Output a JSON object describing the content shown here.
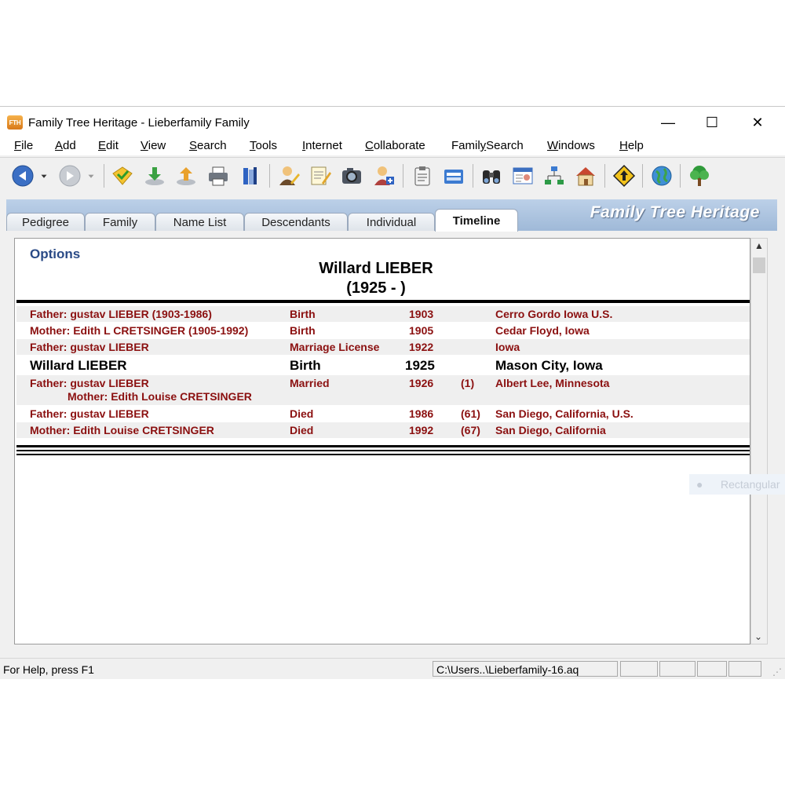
{
  "window": {
    "app_icon": "FTH",
    "title": "Family Tree Heritage - Lieberfamily Family",
    "controls": {
      "minimize": "—",
      "maximize": "☐",
      "close": "✕"
    }
  },
  "menu": [
    {
      "label": "File",
      "u": "F",
      "rest": "ile"
    },
    {
      "label": "Add",
      "u": "A",
      "rest": "dd"
    },
    {
      "label": "Edit",
      "u": "E",
      "rest": "dit"
    },
    {
      "label": "View",
      "u": "V",
      "rest": "iew"
    },
    {
      "label": "Search",
      "u": "S",
      "rest": "earch"
    },
    {
      "label": "Tools",
      "u": "T",
      "rest": "ools"
    },
    {
      "label": "Internet",
      "u": "I",
      "rest": "nternet"
    },
    {
      "label": "Collaborate",
      "u": "C",
      "rest": "ollaborate"
    },
    {
      "label": "FamilySearch",
      "pre": "Famil",
      "u": "y",
      "rest": "Search"
    },
    {
      "label": "Windows",
      "u": "W",
      "rest": "indows"
    },
    {
      "label": "Help",
      "u": "H",
      "rest": "elp"
    }
  ],
  "toolbar_icons": [
    "back-arrow-icon",
    "dropdown-arrow-icon",
    "forward-arrow-icon",
    "dropdown-arrow-icon",
    "open-file-icon",
    "download-icon",
    "upload-icon",
    "print-icon",
    "books-icon",
    "edit-person-icon",
    "notes-icon",
    "camera-icon",
    "add-person-icon",
    "clipboard-icon",
    "card-file-icon",
    "binoculars-icon",
    "profile-card-icon",
    "tree-chart-icon",
    "home-icon",
    "direction-sign-icon",
    "globe-icon",
    "tree-icon"
  ],
  "brand": "Family Tree Heritage",
  "tabs": [
    {
      "label": "Pedigree",
      "active": false
    },
    {
      "label": "Family",
      "active": false
    },
    {
      "label": "Name List",
      "active": false
    },
    {
      "label": "Descendants",
      "active": false
    },
    {
      "label": "Individual",
      "active": false
    },
    {
      "label": "Timeline",
      "active": true
    }
  ],
  "timeline": {
    "options_label": "Options",
    "person_name": "Willard LIEBER",
    "person_dates": "(1925 - )",
    "rows": [
      {
        "name": "Father: gustav LIEBER (1903-1986)",
        "event": "Birth",
        "year": "1903",
        "age": "",
        "place": "Cerro Gordo Iowa U.S."
      },
      {
        "name": "Mother: Edith L CRETSINGER (1905-1992)",
        "event": "Birth",
        "year": "1905",
        "age": "",
        "place": "Cedar Floyd, Iowa"
      },
      {
        "name": "Father: gustav LIEBER",
        "event": "Marriage License",
        "year": "1922",
        "age": "",
        "place": "Iowa"
      },
      {
        "name": "Willard LIEBER",
        "event": "Birth",
        "year": "1925",
        "age": "",
        "place": "Mason City, Iowa"
      },
      {
        "name": "Father: gustav LIEBER",
        "name2": "Mother: Edith Louise CRETSINGER",
        "event": "Married",
        "year": "1926",
        "age": "(1)",
        "place": "Albert Lee, Minnesota"
      },
      {
        "name": "Father: gustav LIEBER",
        "event": "Died",
        "year": "1986",
        "age": "(61)",
        "place": "San Diego, California, U.S."
      },
      {
        "name": "Mother: Edith Louise CRETSINGER",
        "event": "Died",
        "year": "1992",
        "age": "(67)",
        "place": "San Diego, California"
      }
    ]
  },
  "overlay": {
    "icon": "●",
    "text": "Rectangular"
  },
  "status": {
    "help": "For Help, press F1",
    "path": "C:\\Users..\\Lieberfamily-16.aq"
  },
  "scrollbar": {
    "up": "▲",
    "down": "⌄"
  }
}
